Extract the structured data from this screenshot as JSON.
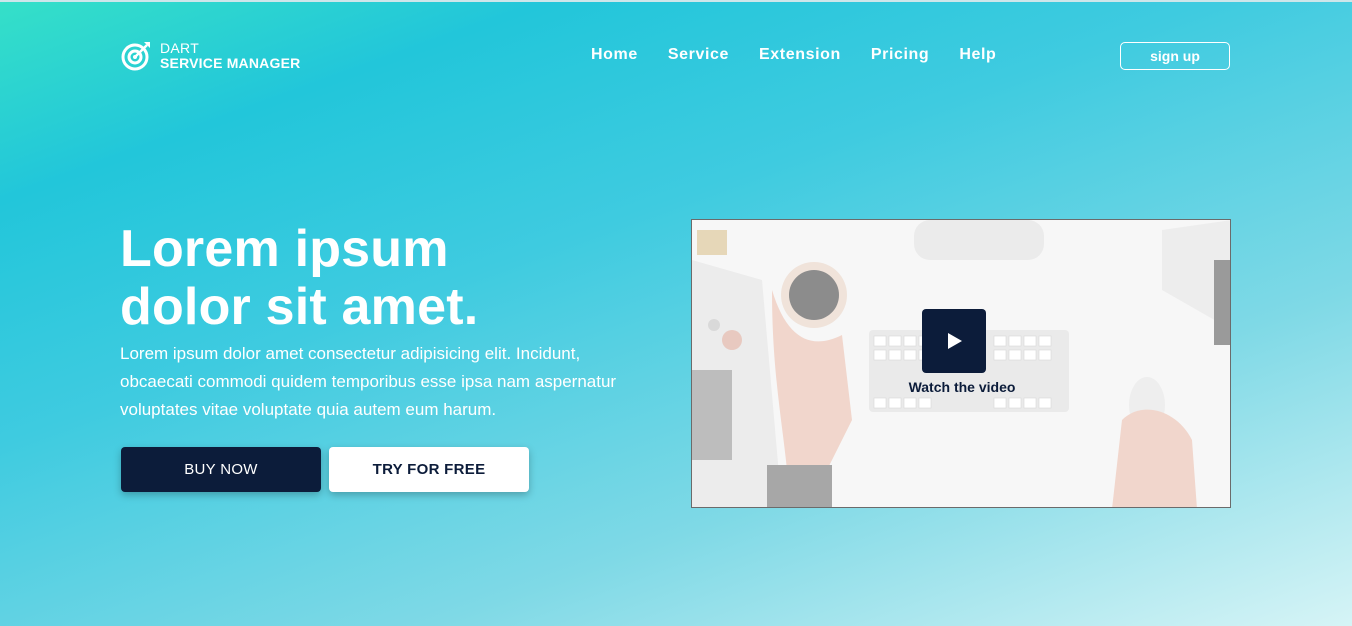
{
  "header": {
    "logo_line1": "DART",
    "logo_line2": "SERVICE MANAGER",
    "nav": [
      "Home",
      "Service",
      "Extension",
      "Pricing",
      "Help"
    ],
    "signup_label": "sign up"
  },
  "hero": {
    "title_line1": "Lorem ipsum",
    "title_line2": "dolor sit amet.",
    "description": "Lorem ipsum dolor amet consectetur adipisicing elit. Incidunt, obcaecati commodi quidem temporibus esse ipsa nam aspernatur voluptates vitae voluptate quia autem eum harum.",
    "buy_label": "BUY NOW",
    "try_label": "TRY FOR FREE"
  },
  "video": {
    "watch_label": "Watch the video",
    "play_icon": "play-icon"
  },
  "colors": {
    "accent_dark": "#0c1c3a",
    "gradient_start": "#35e0c8",
    "gradient_end": "#d6f4f6"
  }
}
